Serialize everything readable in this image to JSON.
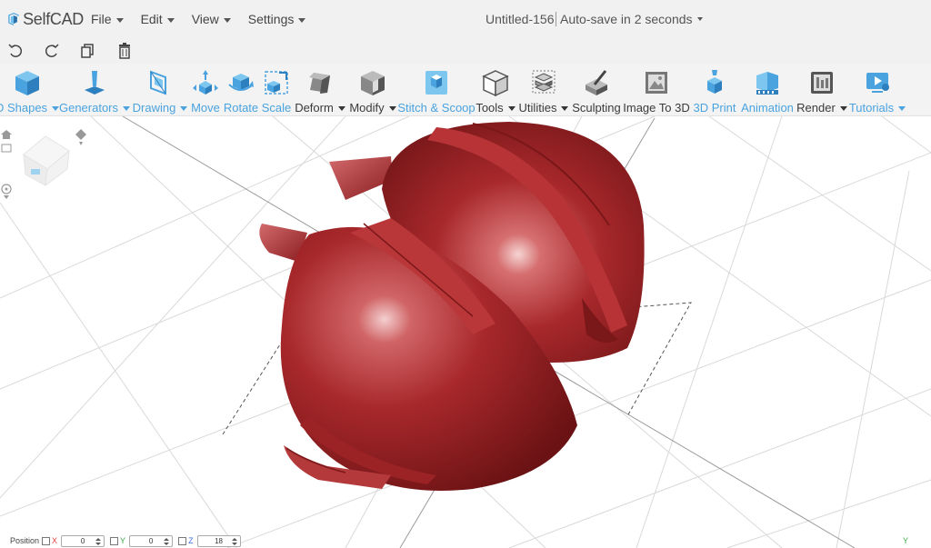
{
  "app": {
    "name": "SelfCAD",
    "menus": [
      "File",
      "Edit",
      "View",
      "Settings"
    ],
    "document_title": "Untitled-156",
    "autosave_text": "Auto-save in 2 seconds"
  },
  "quickbar": {
    "icons": [
      "undo-icon",
      "redo-icon",
      "copy-icon",
      "trash-icon"
    ]
  },
  "ribbon": {
    "tools": [
      {
        "label": "D Shapes",
        "icon": "cube-icon",
        "dropdown": true,
        "style": "blue"
      },
      {
        "label": "Generators",
        "icon": "generator-icon",
        "dropdown": true,
        "style": "blue"
      },
      {
        "label": "Drawing",
        "icon": "drawing-icon",
        "dropdown": true,
        "style": "blue"
      },
      {
        "label": "Move",
        "icon": "move-icon",
        "dropdown": false,
        "style": "blue"
      },
      {
        "label": "Rotate",
        "icon": "rotate-icon",
        "dropdown": false,
        "style": "blue"
      },
      {
        "label": "Scale",
        "icon": "scale-icon",
        "dropdown": false,
        "style": "blue"
      },
      {
        "label": "Deform",
        "icon": "deform-icon",
        "dropdown": true,
        "style": "dark"
      },
      {
        "label": "Modify",
        "icon": "modify-icon",
        "dropdown": true,
        "style": "dark"
      },
      {
        "label": "Stitch & Scoop",
        "icon": "stitch-scoop-icon",
        "dropdown": false,
        "style": "blue"
      },
      {
        "label": "Tools",
        "icon": "tools-icon",
        "dropdown": true,
        "style": "dark"
      },
      {
        "label": "Utilities",
        "icon": "utilities-icon",
        "dropdown": true,
        "style": "dark"
      },
      {
        "label": "Sculpting",
        "icon": "sculpting-icon",
        "dropdown": false,
        "style": "dark"
      },
      {
        "label": "Image To 3D",
        "icon": "image-to-3d-icon",
        "dropdown": false,
        "style": "dark"
      },
      {
        "label": "3D Print",
        "icon": "3d-print-icon",
        "dropdown": false,
        "style": "blue"
      },
      {
        "label": "Animation",
        "icon": "animation-icon",
        "dropdown": false,
        "style": "blue"
      },
      {
        "label": "Render",
        "icon": "render-icon",
        "dropdown": true,
        "style": "dark"
      },
      {
        "label": "Tutorials",
        "icon": "tutorials-icon",
        "dropdown": true,
        "style": "blue"
      }
    ]
  },
  "position": {
    "label": "Position",
    "x_label": "X",
    "x_value": "0",
    "y_label": "Y",
    "y_value": "0",
    "z_label": "Z",
    "z_value": "18"
  },
  "viewport": {
    "corner_axis": "Y",
    "model_color": "#a8282b",
    "accent": "#4aa3df"
  }
}
